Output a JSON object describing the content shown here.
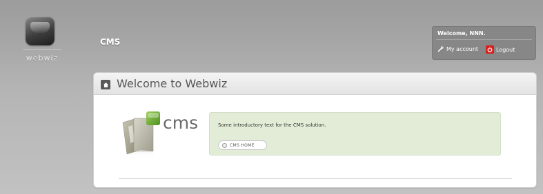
{
  "brand": {
    "logo_text": "webwiz"
  },
  "header": {
    "title": "CMS"
  },
  "user": {
    "welcome": "Welcome, NNN.",
    "my_account_label": "My account",
    "logout_label": "Logout"
  },
  "panel": {
    "title": "Welcome to Webwiz"
  },
  "cms_logo": {
    "text": "cms"
  },
  "intro": {
    "text": "Some introductory text for the CMS solution.",
    "button_label": "CMS HOME"
  },
  "colors": {
    "page_background": "#b0b0b0",
    "user_box": "#878787",
    "intro_box": "#e2ecd6",
    "logout_icon": "#d62020",
    "cms_logo_green": "#7cb342"
  },
  "icons": {
    "account": "wrench-icon",
    "logout": "power-icon",
    "panel_header": "home-icon",
    "button": "circle-icon"
  }
}
